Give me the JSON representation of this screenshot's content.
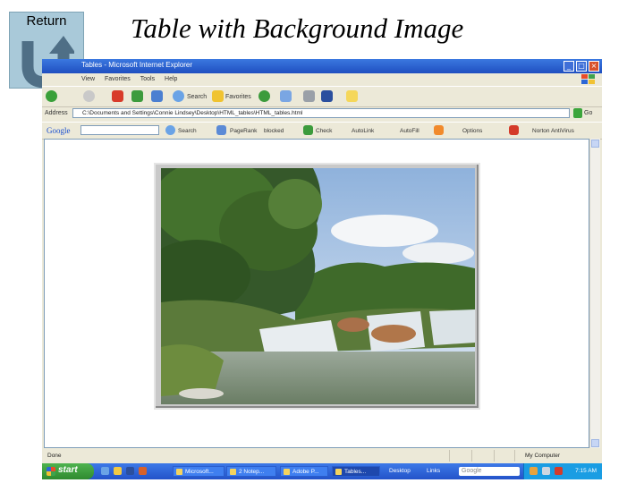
{
  "return": {
    "label": "Return"
  },
  "slide": {
    "title": "Table with Background Image"
  },
  "browser": {
    "title": "Tables - Microsoft Internet Explorer",
    "menu": [
      "View",
      "Favorites",
      "Tools",
      "Help"
    ],
    "toolbar": {
      "search": "Search",
      "favorites": "Favorites"
    },
    "address": {
      "label": "Address",
      "value": "C:\\Documents and Settings\\Connie Lindsey\\Desktop\\HTML_tables\\HTML_tables.html",
      "go": "Go"
    },
    "google": {
      "logo": "Google",
      "search": "Search",
      "pagerank": "PageRank",
      "blocked": "blocked",
      "check": "Check",
      "autolink": "AutoLink",
      "autofill": "AutoFill",
      "options": "Options",
      "norton": "Norton AntiVirus"
    },
    "status": {
      "text": "Done",
      "zone": "My Computer"
    }
  },
  "taskbar": {
    "start": "start",
    "tasks": [
      "Microsoft...",
      "2 Notep...",
      "Adobe P...",
      "Tables...",
      "Desktop",
      "Links"
    ],
    "search_placeholder": "Google",
    "clock": "7:15 AM"
  },
  "colors": {
    "return_bg": "#a9c9d9",
    "titlebar": "#2355cc",
    "taskbar": "#2f62d8",
    "start_green": "#3a9b3a"
  }
}
